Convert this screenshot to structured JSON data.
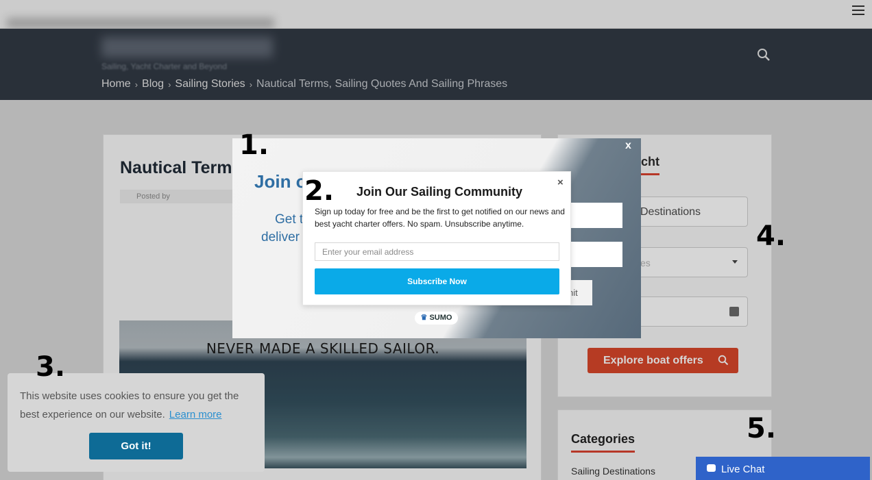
{
  "top": {
    "menu_icon": "hamburger-icon"
  },
  "header": {
    "tagline": "Sailing, Yacht Charter and Beyond",
    "search_icon": "search-icon",
    "breadcrumb": [
      "Home",
      "Blog",
      "Sailing Stories",
      "Nautical Terms, Sailing Quotes And Sailing Phrases"
    ]
  },
  "post": {
    "title": "Nautical Terms",
    "posted_by": "Posted by",
    "image_caption": "NEVER MADE A SKILLED SAILOR."
  },
  "sidebar": {
    "heading": "cht",
    "field1": "Destinations",
    "field2_placeholder": "es",
    "explore_button": "Explore boat offers",
    "categories_heading": "Categories",
    "category_first": "Sailing Destinations"
  },
  "overlay": {
    "bg_title": "Join o",
    "bg_sub_line1": "Get t",
    "bg_sub_line2": "deliver",
    "bg_button": "nit",
    "close": "x",
    "sumo_label": "SUMO"
  },
  "modal": {
    "title": "Join Our Sailing Community",
    "description": "Sign up today for free and be the first to get notified on our news and best yacht charter offers. No spam. Unsubscribe anytime.",
    "email_placeholder": "Enter your email address",
    "subscribe_label": "Subscribe Now",
    "close": "×"
  },
  "cookie": {
    "text": "This website uses cookies to ensure you get the best experience on our website.",
    "learn_more": "Learn more",
    "button": "Got it!"
  },
  "live_chat": {
    "label": "Live Chat"
  },
  "steps": [
    "1.",
    "2.",
    "3.",
    "4.",
    "5."
  ],
  "colors": {
    "header_bg": "#323a45",
    "subscribe": "#0aaae8",
    "explore": "#d9472a",
    "cookie_button": "#0e6b96",
    "live_chat": "#2f63c9"
  }
}
